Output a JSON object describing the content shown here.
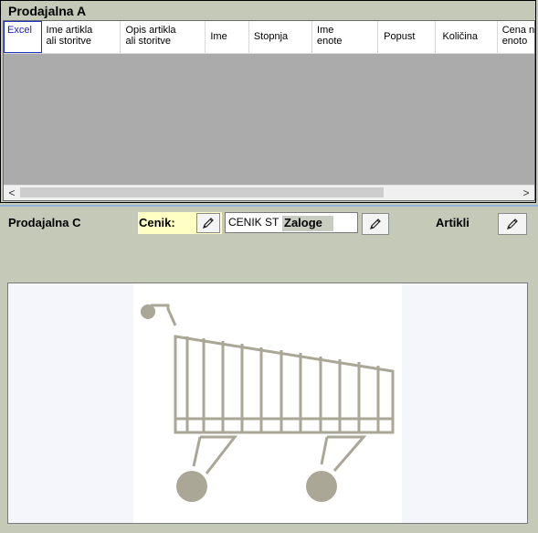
{
  "panel_a": {
    "title": "Prodajalna A",
    "columns": [
      {
        "line1": "Excel",
        "line2": ""
      },
      {
        "line1": "Ime artikla",
        "line2": "ali storitve"
      },
      {
        "line1": "Opis artikla",
        "line2": "ali storitve"
      },
      {
        "line1": "Ime",
        "line2": ""
      },
      {
        "line1": "Stopnja",
        "line2": ""
      },
      {
        "line1": "Ime",
        "line2": "enote"
      },
      {
        "line1": "Popust",
        "line2": ""
      },
      {
        "line1": "Količina",
        "line2": ""
      },
      {
        "line1": "Cena na",
        "line2": "enoto"
      }
    ],
    "scroll_left": "<",
    "scroll_right": ">"
  },
  "panel_c": {
    "title": "Prodajalna C",
    "cenik_label": "Cenik:",
    "cenik_value": "CENIK ST",
    "zaloge_label": "Zaloge",
    "artikli_label": "Artikli"
  },
  "icons": {
    "edit": "pencil-icon",
    "image": "shopping-cart-icon"
  },
  "colors": {
    "background": "#c5c9b8",
    "grid_body": "#ababab",
    "cenik_highlight": "#ffffc4",
    "cart_gray": "#aaa797",
    "excel_blue": "#1a1ad0"
  }
}
